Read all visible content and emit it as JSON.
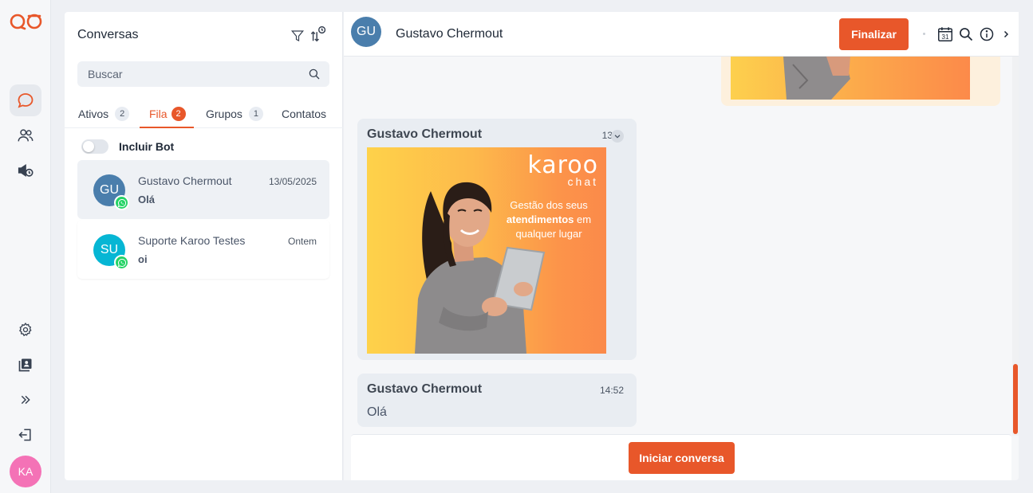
{
  "app": {
    "logo": "karoo-logo",
    "accent": "#e8572a"
  },
  "rail": {
    "items": [
      {
        "name": "chat-icon",
        "active": true
      },
      {
        "name": "contacts-icon"
      },
      {
        "name": "campaign-icon"
      }
    ],
    "bottom": [
      {
        "name": "gear-icon"
      },
      {
        "name": "reports-icon"
      },
      {
        "name": "expand-icon"
      },
      {
        "name": "logout-icon"
      }
    ],
    "user_initials": "KA"
  },
  "conversations": {
    "title": "Conversas",
    "search_placeholder": "Buscar",
    "tabs": [
      {
        "label": "Ativos",
        "count": "2"
      },
      {
        "label": "Fila",
        "count": "2",
        "active": true
      },
      {
        "label": "Grupos",
        "count": "1"
      },
      {
        "label": "Contatos"
      }
    ],
    "include_bot_label": "Incluir Bot",
    "include_bot_on": false,
    "items": [
      {
        "initials": "GU",
        "name": "Gustavo Chermout",
        "last_message": "Olá",
        "date": "13/05/2025",
        "avatar_color": "#4a7eac",
        "channel": "whatsapp-icon",
        "selected": true
      },
      {
        "initials": "SU",
        "name": "Suporte Karoo Testes",
        "last_message": "oi",
        "date": "Ontem",
        "avatar_color": "#06b6d4",
        "channel": "whatsapp-icon"
      }
    ]
  },
  "chat": {
    "contact_initials": "GU",
    "contact_name": "Gustavo Chermout",
    "finalize_label": "Finalizar",
    "header_icons": [
      "calendar-icon",
      "search-icon",
      "info-icon",
      "chevron-right-icon"
    ],
    "calendar_day": "31",
    "messages": [
      {
        "sender": "Gustavo Chermout",
        "time": "13",
        "type": "image",
        "image": {
          "brand": "karoo",
          "brand_sub": "chat",
          "tagline_1": "Gestão dos seus",
          "tagline_bold": "atendimentos",
          "tagline_2": "em",
          "tagline_3": "qualquer lugar"
        }
      },
      {
        "sender": "Gustavo Chermout",
        "time": "14:52",
        "type": "text",
        "text": "Olá"
      }
    ],
    "start_label": "Iniciar conversa"
  }
}
